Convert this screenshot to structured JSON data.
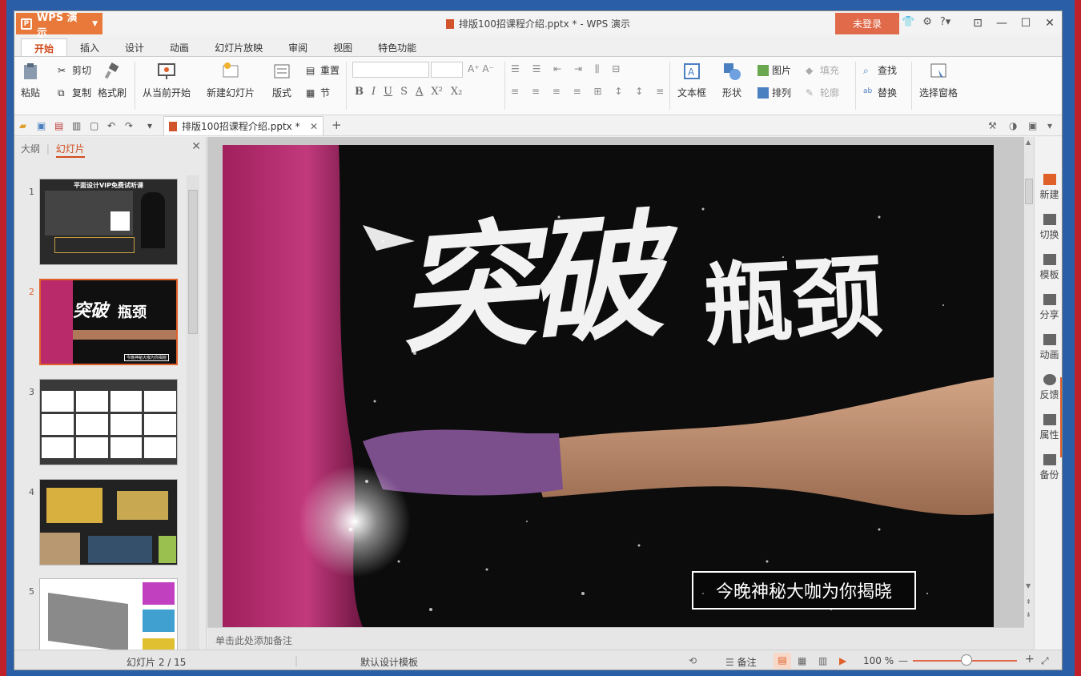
{
  "app": {
    "name": "WPS 演示",
    "window_title": "排版100招课程介绍.pptx * - WPS 演示",
    "login_label": "未登录"
  },
  "ribbon_tabs": [
    "开始",
    "插入",
    "设计",
    "动画",
    "幻灯片放映",
    "审阅",
    "视图",
    "特色功能"
  ],
  "ribbon": {
    "paste": "粘贴",
    "cut": "剪切",
    "copy": "复制",
    "format_painter": "格式刷",
    "from_current": "从当前开始",
    "new_slide": "新建幻灯片",
    "layout": "版式",
    "reset": "重置",
    "section": "节",
    "textbox": "文本框",
    "shape": "形状",
    "picture": "图片",
    "fill": "填充",
    "arrange": "排列",
    "outline": "轮廓",
    "find": "查找",
    "replace": "替换",
    "select_pane": "选择窗格",
    "fmt_buttons": [
      "B",
      "I",
      "U",
      "S",
      "A",
      "X²",
      "X₂"
    ]
  },
  "doc_tab": {
    "label": "排版100招课程介绍.pptx *"
  },
  "left_panel": {
    "tab_outline": "大纲",
    "tab_slides": "幻灯片",
    "thumb_numbers": [
      "1",
      "2",
      "3",
      "4",
      "5"
    ],
    "thumb1_banner": "平面设计VIP免费试听课",
    "thumb2_caption": "今晚神秘大咖为你揭晓"
  },
  "slide": {
    "headline_1": "突破",
    "headline_2": "瓶颈",
    "caption": "今晚神秘大咖为你揭晓"
  },
  "notes_placeholder": "单击此处添加备注",
  "right_pane": [
    "新建",
    "切换",
    "模板",
    "分享",
    "动画",
    "反馈",
    "属性",
    "备份"
  ],
  "status": {
    "slide_counter": "幻灯片 2 / 15",
    "template": "默认设计模板",
    "notes": "备注",
    "zoom": "100 %"
  }
}
